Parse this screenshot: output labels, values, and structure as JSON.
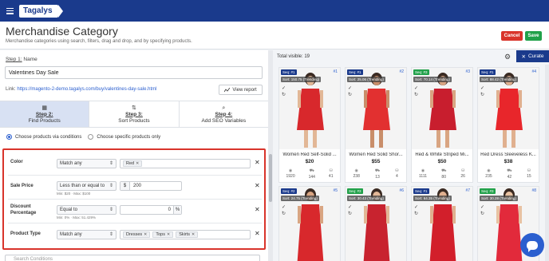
{
  "app": {
    "logo": "Tagalys"
  },
  "header": {
    "title": "Merchandise Category",
    "subtitle": "Merchandise categories using search, filters, drag and drop, and by specifying products.",
    "cancel_label": "Cancel",
    "save_label": "Save"
  },
  "colors": {
    "topbar": "#1a3a8c",
    "cancel": "#d9342b",
    "save": "#21a14a",
    "active_step": "#d8e1f3",
    "highlight_border": "#d9342b",
    "link": "#2b5fcf"
  },
  "name_section": {
    "step_label": "Step 1:",
    "field_label": "Name",
    "value": "Valentines Day Sale",
    "link_label": "Link:",
    "link_url": "https://magento-2-demo.tagalys.com/buy/valentines-day-sale.html",
    "view_report_label": "View report"
  },
  "steps": [
    {
      "num": "Step 2:",
      "label": "Find Products",
      "icon": "grid-icon",
      "active": true
    },
    {
      "num": "Step 3:",
      "label": "Sort Products",
      "icon": "sort-icon",
      "active": false
    },
    {
      "num": "Step 4:",
      "label": "Add SEO Variables",
      "icon": "search-icon",
      "active": false
    }
  ],
  "mode": {
    "option_conditions": "Choose products via conditions",
    "option_specific": "Choose specific products only",
    "selected": "conditions"
  },
  "conditions": [
    {
      "label": "Color",
      "operator": "Match any",
      "tags": [
        "Red"
      ]
    },
    {
      "label": "Sale Price",
      "operator": "Less than or equal to",
      "currency": "$",
      "value": "200",
      "hint": "Min: $20 · Max: $100"
    },
    {
      "label": "Discount Percentage",
      "operator": "Equal to",
      "value": "0",
      "unit": "%",
      "hint": "Min: 0% · Max: 51.429%"
    },
    {
      "label": "Product Type",
      "operator": "Match any",
      "tags": [
        "Dresses",
        "Tops",
        "Skirts"
      ]
    }
  ],
  "search_conditions_placeholder": "Search Conditions",
  "results": {
    "total_label": "Total visible: 19",
    "curate_label": "Curate",
    "products": [
      {
        "seq": "Seq: #1",
        "seq_color": "#1a3a8c",
        "sort": "Sort: 150.75 (Trending)",
        "pos": "#1",
        "name": "Women Red Self-Solid ...",
        "price": "$20",
        "stats": [
          "1920",
          "144",
          "41"
        ],
        "dress": "#d8282c",
        "skin": "#e2b796"
      },
      {
        "seq": "Seq: #1",
        "seq_color": "#1a3a8c",
        "sort": "Sort: 25.06 (Trending)",
        "pos": "#2",
        "name": "Women Red Solid Shor...",
        "price": "$55",
        "stats": [
          "238",
          "13",
          "4"
        ],
        "dress": "#e23030",
        "skin": "#c98e6a"
      },
      {
        "seq": "Seq: #3",
        "seq_color": "#21a14a",
        "sort": "Sort: 70.14 (Trending)",
        "pos": "#3",
        "name": "Red & White Striped Mi...",
        "price": "$50",
        "stats": [
          "1111",
          "80",
          "26"
        ],
        "dress": "#c81e2e",
        "skin": "#d9a582"
      },
      {
        "seq": "Seq: #1",
        "seq_color": "#1a3a8c",
        "sort": "Sort: 88.42 (Trending)",
        "pos": "#4",
        "name": "Red Dress Sleeveless K...",
        "price": "$38",
        "stats": [
          "235",
          "42",
          "15"
        ],
        "dress": "#e8262b",
        "skin": "#e0b08f"
      },
      {
        "seq": "Seq: #2",
        "seq_color": "#1a3a8c",
        "sort": "Sort: 24.75 (Trending)",
        "pos": "#5",
        "dress": "#d8282c",
        "skin": "#d9a582"
      },
      {
        "seq": "Seq: #3",
        "seq_color": "#21a14a",
        "sort": "Sort: 30.43 (Trending)",
        "pos": "#6",
        "dress": "#c8232f",
        "skin": "#e2b796"
      },
      {
        "seq": "Seq: #1",
        "seq_color": "#1a3a8c",
        "sort": "Sort: 64.35 (Trending)",
        "pos": "#7",
        "dress": "#d21f2b",
        "skin": "#e0b08f"
      },
      {
        "seq": "Seq: #3",
        "seq_color": "#21a14a",
        "sort": "Sort: 30.28 (Trending)",
        "pos": "#8",
        "dress": "#e22a3b",
        "skin": "#e8c2a2"
      }
    ]
  }
}
